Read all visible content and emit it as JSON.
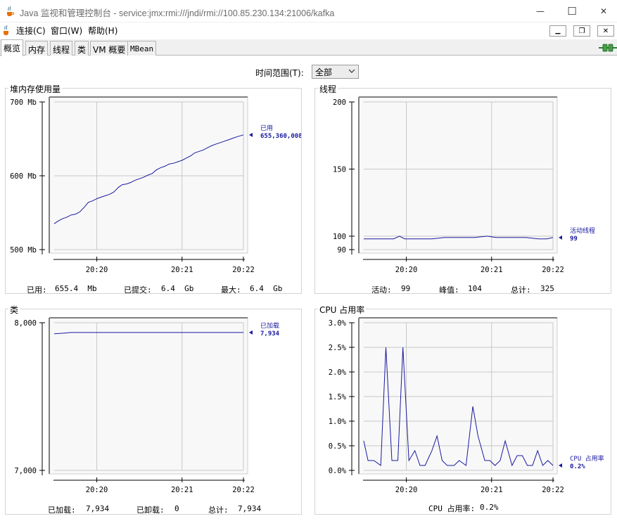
{
  "window": {
    "title": "Java 监视和管理控制台 - service:jmx:rmi:///jndi/rmi://100.85.230.134:21006/kafka",
    "minimize_glyph": "—",
    "maximize_glyph": "☐",
    "close_glyph": "✕"
  },
  "menu": {
    "items": [
      {
        "label": "连接(C)"
      },
      {
        "label": "窗口(W)"
      },
      {
        "label": "帮助(H)"
      }
    ],
    "mdi_minimize": "▁",
    "mdi_restore": "❐",
    "mdi_close": "✕"
  },
  "tabs": [
    {
      "label": "概览",
      "active": true
    },
    {
      "label": "内存"
    },
    {
      "label": "线程"
    },
    {
      "label": "类"
    },
    {
      "label": "VM 概要"
    },
    {
      "label": "MBean"
    }
  ],
  "time_range": {
    "label": "时间范围(T):",
    "selected": "全部"
  },
  "icons": {
    "app": "java-cup-icon",
    "connection": "connection-plug-icon",
    "chevron": "chevron-down-icon"
  },
  "colors": {
    "series": "#1a1aa0",
    "grid": "#c8c8c8",
    "plot_bg": "#f8f8f8"
  },
  "panels": {
    "heap": {
      "title": "堆内存使用量",
      "stats": {
        "used_label": "已用:",
        "used_value": "655.4  Mb",
        "committed_label": "已提交:",
        "committed_value": "6.4  Gb",
        "max_label": "最大:",
        "max_value": "6.4  Gb"
      }
    },
    "threads": {
      "title": "线程",
      "stats": {
        "live_label": "活动:",
        "live_value": "99",
        "peak_label": "峰值:",
        "peak_value": "104",
        "total_label": "总计:",
        "total_value": "325"
      }
    },
    "classes": {
      "title": "类",
      "stats": {
        "loaded_label": "已加载:",
        "loaded_value": "7,934",
        "unloaded_label": "已卸载:",
        "unloaded_value": "0",
        "total_label": "总计:",
        "total_value": "7,934"
      }
    },
    "cpu": {
      "title": "CPU 占用率",
      "stats": {
        "usage_label": "CPU 占用率:",
        "usage_value": "0.2%"
      }
    }
  },
  "chart_data": [
    {
      "id": "heap",
      "type": "line",
      "ylim": [
        500,
        700
      ],
      "yticks": [
        500,
        600,
        700
      ],
      "ytick_labels": [
        "500 Mb",
        "600 Mb",
        "700 Mb"
      ],
      "xlim": [
        0,
        2.22
      ],
      "xticks": [
        0.5,
        1.5,
        2.5
      ],
      "xtick_labels": [
        "20:20",
        "20:21",
        "20:22"
      ],
      "grid": true,
      "series": [
        {
          "name": "已用",
          "current": "655,360,008",
          "x": [
            0,
            0.05,
            0.1,
            0.15,
            0.2,
            0.25,
            0.3,
            0.35,
            0.4,
            0.45,
            0.5,
            0.55,
            0.6,
            0.65,
            0.7,
            0.75,
            0.8,
            0.85,
            0.9,
            0.95,
            1.0,
            1.05,
            1.1,
            1.15,
            1.2,
            1.25,
            1.3,
            1.35,
            1.4,
            1.45,
            1.5,
            1.55,
            1.6,
            1.65,
            1.7,
            1.75,
            1.8,
            1.85,
            1.9,
            1.95,
            2.0,
            2.05,
            2.1,
            2.15,
            2.22
          ],
          "values": [
            535,
            539,
            542,
            544,
            547,
            548,
            551,
            557,
            564,
            566,
            569,
            571,
            573,
            575,
            578,
            584,
            588,
            589,
            591,
            594,
            596,
            598,
            601,
            603,
            608,
            611,
            613,
            616,
            617,
            619,
            621,
            624,
            627,
            631,
            633,
            635,
            638,
            641,
            643,
            645,
            647,
            649,
            651,
            653,
            655.4
          ]
        }
      ]
    },
    {
      "id": "threads",
      "type": "line",
      "ylim": [
        90,
        200
      ],
      "yticks": [
        90,
        100,
        150,
        200
      ],
      "ytick_labels": [
        "90",
        "100",
        "150",
        "200"
      ],
      "xlim": [
        0,
        2.22
      ],
      "xticks": [
        0.5,
        1.5,
        2.5
      ],
      "xtick_labels": [
        "20:20",
        "20:21",
        "20:22"
      ],
      "grid": true,
      "series": [
        {
          "name": "活动线程",
          "current": "99",
          "x": [
            0,
            0.35,
            0.42,
            0.48,
            0.8,
            0.95,
            1.3,
            1.45,
            1.55,
            1.9,
            2.05,
            2.15,
            2.22
          ],
          "values": [
            98,
            98,
            100,
            98,
            98,
            99,
            99,
            100,
            99,
            99,
            98,
            98,
            99
          ]
        }
      ]
    },
    {
      "id": "classes",
      "type": "line",
      "ylim": [
        7000,
        8000
      ],
      "yticks": [
        7000,
        8000
      ],
      "ytick_labels": [
        "7,000",
        "8,000"
      ],
      "xlim": [
        0,
        2.22
      ],
      "xticks": [
        0.5,
        1.5,
        2.5
      ],
      "xtick_labels": [
        "20:20",
        "20:21",
        "20:22"
      ],
      "grid": true,
      "series": [
        {
          "name": "已加载",
          "current": "7,934",
          "x": [
            0,
            0.12,
            0.2,
            2.22
          ],
          "values": [
            7925,
            7930,
            7934,
            7934
          ]
        }
      ]
    },
    {
      "id": "cpu",
      "type": "line",
      "ylim": [
        0,
        3.0
      ],
      "yticks": [
        0,
        0.5,
        1.0,
        1.5,
        2.0,
        2.5,
        3.0
      ],
      "ytick_labels": [
        "0.0%",
        "0.5%",
        "1.0%",
        "1.5%",
        "2.0%",
        "2.5%",
        "3.0%"
      ],
      "xlim": [
        0,
        2.22
      ],
      "xticks": [
        0.5,
        1.5,
        2.5
      ],
      "xtick_labels": [
        "20:20",
        "20:21",
        "20:22"
      ],
      "grid": true,
      "series": [
        {
          "name": "CPU 占用率",
          "current": "0.2%",
          "x": [
            0,
            0.05,
            0.12,
            0.2,
            0.26,
            0.33,
            0.4,
            0.46,
            0.53,
            0.6,
            0.66,
            0.72,
            0.8,
            0.86,
            0.92,
            0.98,
            1.06,
            1.12,
            1.2,
            1.28,
            1.34,
            1.42,
            1.48,
            1.54,
            1.6,
            1.66,
            1.74,
            1.8,
            1.86,
            1.92,
            1.98,
            2.04,
            2.1,
            2.16,
            2.22
          ],
          "values": [
            0.6,
            0.2,
            0.2,
            0.1,
            2.5,
            0.2,
            0.2,
            2.5,
            0.2,
            0.4,
            0.1,
            0.1,
            0.4,
            0.7,
            0.2,
            0.1,
            0.1,
            0.2,
            0.1,
            1.3,
            0.7,
            0.2,
            0.2,
            0.1,
            0.2,
            0.6,
            0.1,
            0.3,
            0.3,
            0.1,
            0.1,
            0.4,
            0.1,
            0.2,
            0.1
          ]
        }
      ]
    }
  ]
}
